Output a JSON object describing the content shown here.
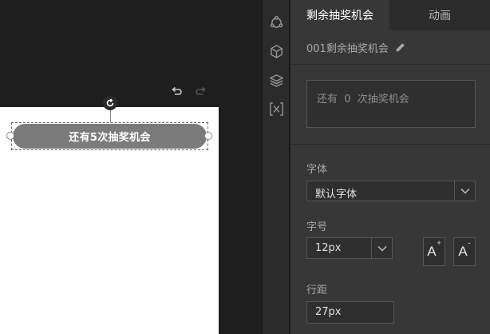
{
  "canvas": {
    "element_text": "还有5次抽奖机会"
  },
  "sidebar": {
    "icons": [
      "shape-nodes-icon",
      "cube-icon",
      "layers-icon",
      "variable-icon"
    ]
  },
  "panel": {
    "tabs": [
      {
        "label": "剩余抽奖机会",
        "active": true
      },
      {
        "label": "动画",
        "active": false
      }
    ],
    "component_name": "001剩余抽奖机会",
    "text_content": "还有  0  次抽奖机会",
    "font": {
      "label": "字体",
      "value": "默认字体"
    },
    "font_size": {
      "label": "字号",
      "value": "12px",
      "increase_symbol": "+",
      "decrease_symbol": "-"
    },
    "line_height": {
      "label": "行距",
      "value": "27px"
    }
  },
  "colors": {
    "canvas_bg": "#1e1e1e",
    "panel_bg": "#373737",
    "element_fill": "#7b7b7b"
  }
}
